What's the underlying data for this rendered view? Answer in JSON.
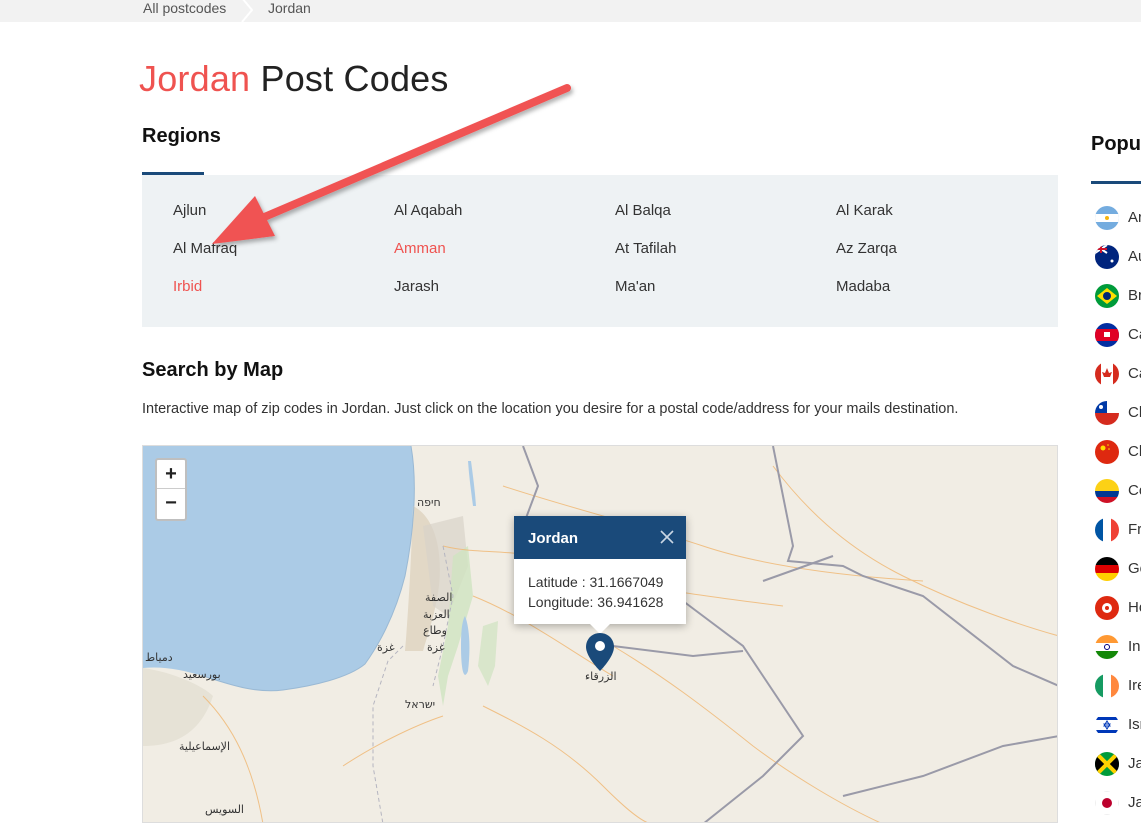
{
  "breadcrumb": {
    "items": [
      "All postcodes",
      "Jordan"
    ]
  },
  "title": {
    "accent": "Jordan",
    "rest": " Post Codes"
  },
  "regions": {
    "heading": "Regions",
    "items": [
      "Ajlun",
      "Al Aqabah",
      "Al Balqa",
      "Al Karak",
      "Al Mafraq",
      "Amman",
      "At Tafilah",
      "Az Zarqa",
      "Irbid",
      "Jarash",
      "Ma'an",
      "Madaba"
    ],
    "active": [
      "Amman",
      "Irbid"
    ]
  },
  "search": {
    "heading": "Search by Map",
    "description": "Interactive map of zip codes in Jordan. Just click on the location you desire for a postal code/address for your mails destination."
  },
  "map": {
    "zoom_in": "+",
    "zoom_out": "−",
    "popup": {
      "title": "Jordan",
      "latitude": "Latitude : 31.1667049",
      "longitude": "Longitude: 36.941628"
    },
    "labels": [
      "חיפה",
      "الصفة",
      "العزبة",
      "وطاع",
      "غزة",
      "غزة",
      "دمياط",
      "بورسعيد",
      "ישראל",
      "الإسماعيلية",
      "السويس",
      "الزرقاء"
    ]
  },
  "sidebar": {
    "heading": "Popu",
    "countries": [
      "Ar",
      "Au",
      "Br",
      "Ca",
      "Ca",
      "Ch",
      "Ch",
      "Co",
      "Fr",
      "Ge",
      "Ho",
      "In",
      "Ire",
      "Isr",
      "Ja",
      "Ja"
    ]
  },
  "colors": {
    "accent": "#ef5350",
    "brand": "#1a4a7a",
    "region_bg": "#eef2f4",
    "sea": "#abcbe6",
    "land": "#f1ede4"
  }
}
